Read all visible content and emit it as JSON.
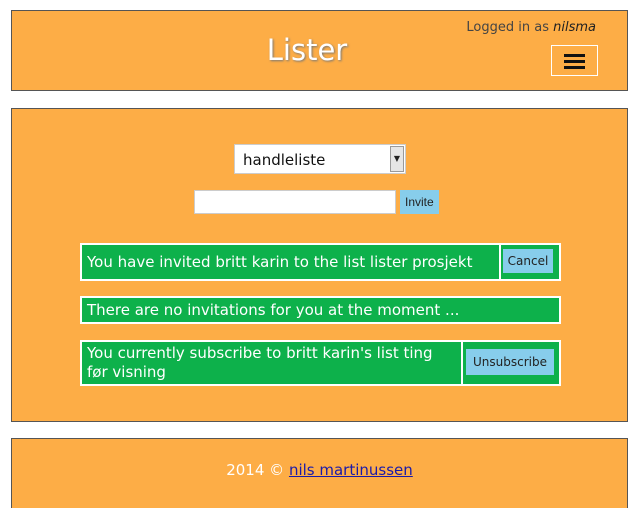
{
  "header": {
    "logged_in_prefix": "Logged in as",
    "username": "nilsma",
    "title": "Lister",
    "menu_icon": "hamburger-icon"
  },
  "main": {
    "list_select": {
      "selected": "handleliste"
    },
    "invite": {
      "value": "",
      "placeholder": "",
      "button_label": "Invite"
    },
    "notices": {
      "sent": {
        "text": "You have invited britt karin to the list lister prosjekt",
        "button": "Cancel"
      },
      "received": {
        "text": "There are no invitations for you at the moment ..."
      },
      "subscription": {
        "text": "You currently subscribe to britt karin's list ting før visning",
        "button": "Unsubscribe"
      }
    }
  },
  "footer": {
    "copyright": "2014 ©",
    "author_link": "nils martinussen"
  },
  "colors": {
    "panel": "#fdad46",
    "notice": "#0db14b",
    "button": "#87cdeb"
  }
}
